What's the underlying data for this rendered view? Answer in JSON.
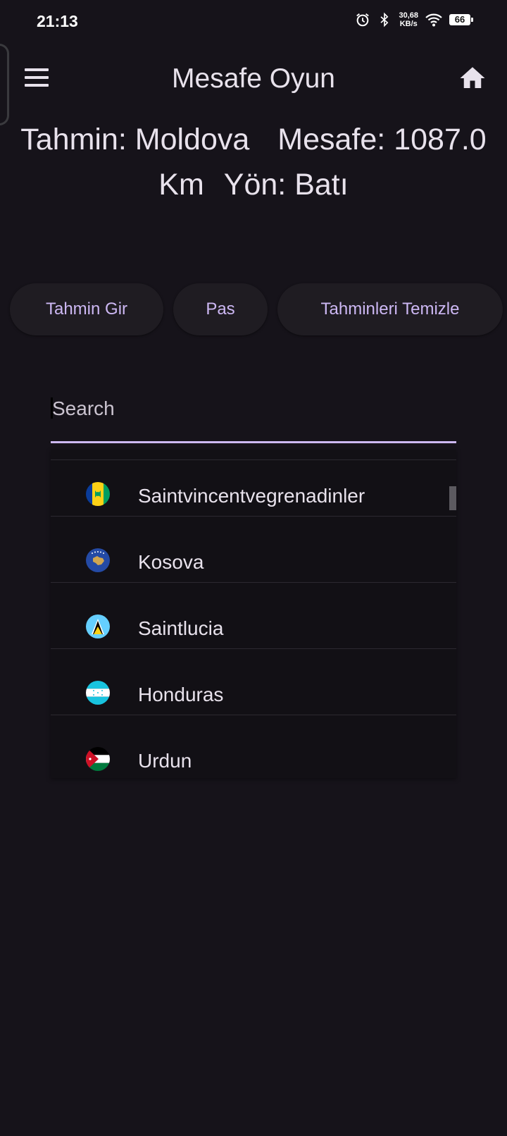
{
  "status_bar": {
    "time": "21:13",
    "net_speed_value": "30,68",
    "net_speed_unit": "KB/s",
    "battery": "66"
  },
  "app_bar": {
    "title": "Mesafe Oyun",
    "menu_icon": "hamburger-menu-icon",
    "home_icon": "home-icon"
  },
  "guess": {
    "label_tahmin": "Tahmin: Moldova",
    "label_mesafe": "Mesafe: 1087.0",
    "label_km": "Km",
    "label_yon": "Yön: Batı"
  },
  "buttons": {
    "submit": "Tahmin Gir",
    "pass": "Pas",
    "clear": "Tahminleri Temizle"
  },
  "search": {
    "placeholder": "Search"
  },
  "countries": [
    {
      "name": "Saintvincentvegrenadinler",
      "flag_icon": "flag-saint-vincent-icon"
    },
    {
      "name": "Kosova",
      "flag_icon": "flag-kosovo-icon"
    },
    {
      "name": "Saintlucia",
      "flag_icon": "flag-saint-lucia-icon"
    },
    {
      "name": "Honduras",
      "flag_icon": "flag-honduras-icon"
    },
    {
      "name": "Urdun",
      "flag_icon": "flag-jordan-icon"
    }
  ],
  "colors": {
    "background": "#16131a",
    "accent": "#cdb8f4",
    "text": "#e8e2ec",
    "button_bg": "#1f1c22"
  }
}
